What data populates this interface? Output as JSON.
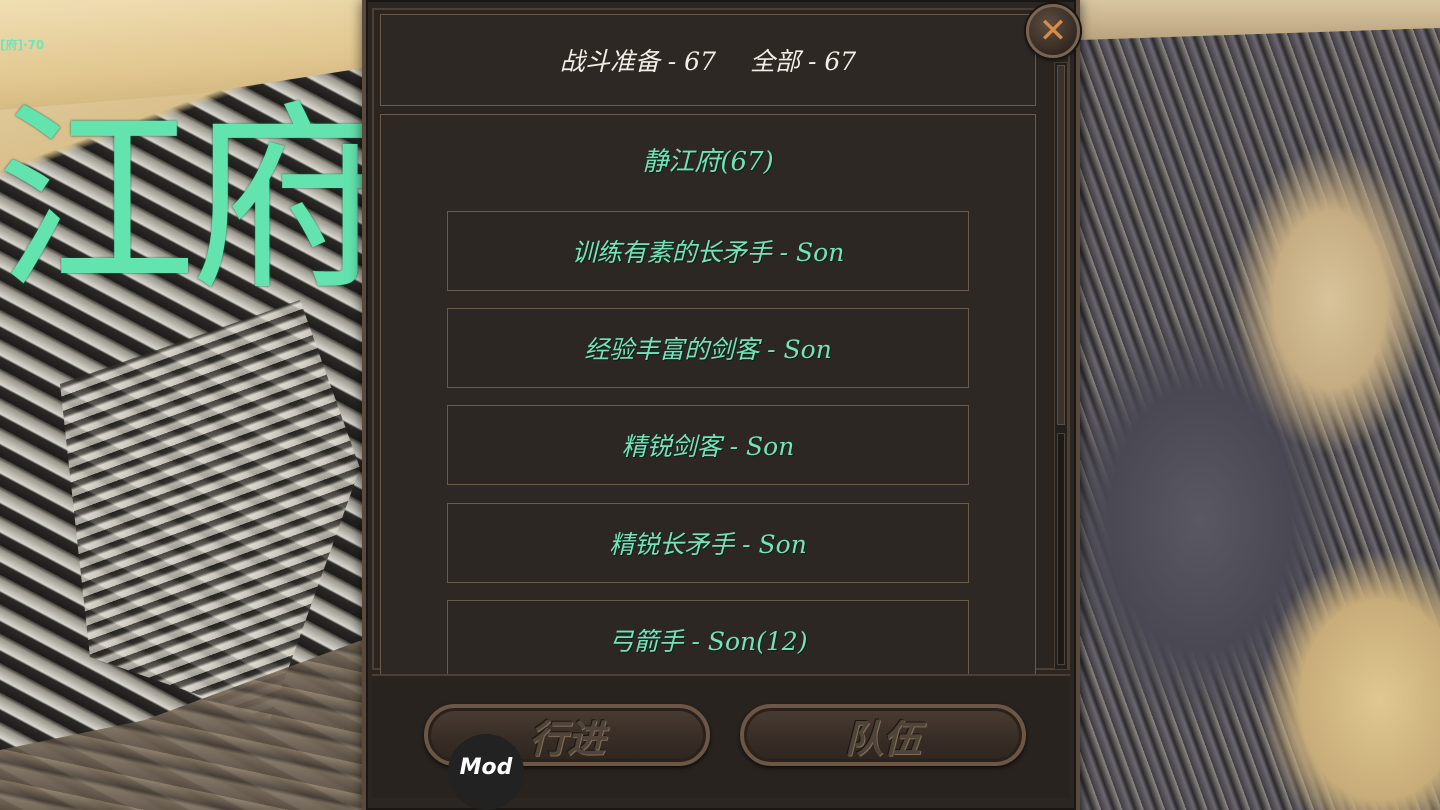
{
  "background": {
    "city_label": "[府]·70",
    "city_banner": "江府"
  },
  "header": {
    "battle_ready": "战斗准备 - 67",
    "total": "全部 - 67"
  },
  "group": {
    "title": "静江府(67)"
  },
  "units": [
    {
      "label": "训练有素的长矛手 - Son"
    },
    {
      "label": "经验丰富的剑客 - Son"
    },
    {
      "label": "精锐剑客 - Son"
    },
    {
      "label": "精锐长矛手 - Son"
    },
    {
      "label": "弓箭手 - Son(12)"
    }
  ],
  "buttons": {
    "close": "✕",
    "advance": "行进",
    "party": "队伍"
  },
  "overlay": {
    "mod_badge": "Mod"
  },
  "colors": {
    "unit_text": "#72e4b8",
    "header_text": "#f2ede4",
    "panel_bg": "#2b2622",
    "close_x": "#d98b4a"
  }
}
